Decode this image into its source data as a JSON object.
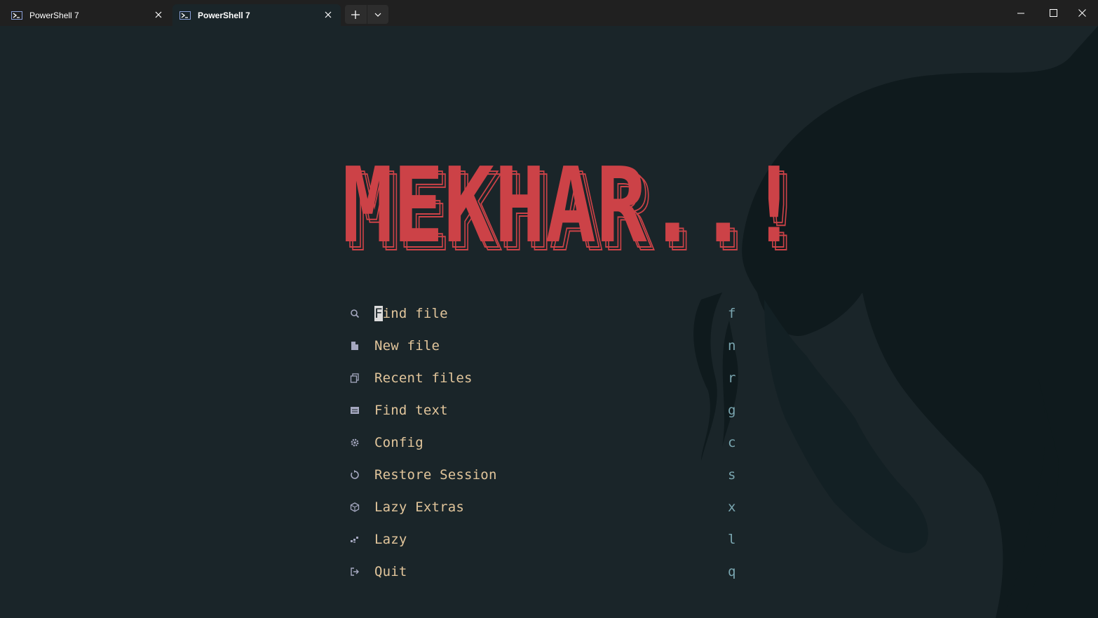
{
  "window": {
    "tabs": [
      {
        "title": "PowerShell 7",
        "active": false
      },
      {
        "title": "PowerShell 7",
        "active": true
      }
    ]
  },
  "banner": {
    "text": "MEKHAR..!",
    "color": "#cc4247"
  },
  "menu": {
    "items": [
      {
        "icon": "search-icon",
        "label": "Find file",
        "key": "f"
      },
      {
        "icon": "file-icon",
        "label": "New file",
        "key": "n"
      },
      {
        "icon": "recent-files-icon",
        "label": "Recent files",
        "key": "r"
      },
      {
        "icon": "text-search-icon",
        "label": "Find text",
        "key": "g"
      },
      {
        "icon": "gear-icon",
        "label": "Config",
        "key": "c"
      },
      {
        "icon": "restore-icon",
        "label": "Restore Session",
        "key": "s"
      },
      {
        "icon": "package-icon",
        "label": "Lazy Extras",
        "key": "x"
      },
      {
        "icon": "lazy-icon",
        "label": "Lazy",
        "key": "l"
      },
      {
        "icon": "quit-icon",
        "label": "Quit",
        "key": "q"
      }
    ]
  },
  "colors": {
    "terminal_bg": "#1a2529",
    "titlebar_bg": "#202020",
    "menu_text": "#e1c59b",
    "key_text": "#7aa6b0",
    "icon_color": "#a5a8c0"
  }
}
